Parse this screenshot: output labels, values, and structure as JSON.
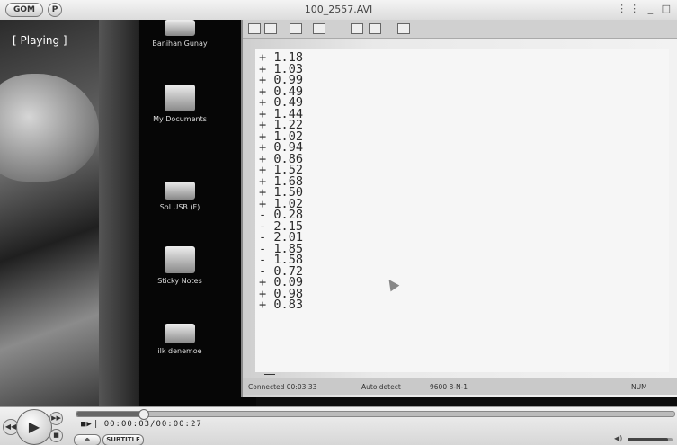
{
  "window": {
    "title": "100_2557.AVI",
    "logo": "GOM",
    "pref_label": "P",
    "controls": "⋮⋮ _ □"
  },
  "video": {
    "status": "[ Playing ]",
    "desktop_icons": [
      {
        "label": "Banihan Gunay",
        "icon": "user-folder-icon"
      },
      {
        "label": "My Documents",
        "icon": "documents-icon"
      },
      {
        "label": "Sol USB (F)",
        "icon": "usb-drive-icon"
      },
      {
        "label": "Sticky Notes",
        "icon": "sticky-notes-icon"
      },
      {
        "label": "ilk denemoe",
        "icon": "file-icon"
      }
    ],
    "terminal": {
      "readings": [
        "+ 1.18",
        "+ 1.03",
        "+ 0.99",
        "+ 0.49",
        "+ 0.49",
        "+ 1.44",
        "+ 1.22",
        "+ 1.02",
        "+ 0.94",
        "+ 0.86",
        "+ 1.52",
        "+ 1.68",
        "+ 1.50",
        "+ 1.02",
        "- 0.28",
        "- 2.15",
        "- 2.01",
        "- 1.85",
        "- 1.58",
        "- 0.72",
        "+ 0.09",
        "+ 0.98",
        "+ 0.83"
      ],
      "status": {
        "connected": "Connected 00:03:33",
        "detect": "Auto detect",
        "settings": "9600 8-N-1",
        "num": "NUM"
      }
    }
  },
  "player": {
    "time": "00:00:03/00:00:27",
    "eject_label": "⏏",
    "subtitle_label": "SUBTITLE",
    "progress": 0.111,
    "volume": 0.9,
    "play_symbol": "▶",
    "prev_symbol": "◀◀",
    "next_symbol": "▶▶",
    "stop_symbol": "■",
    "volume_symbol": "◀)",
    "state_symbols": "■▶‖"
  }
}
